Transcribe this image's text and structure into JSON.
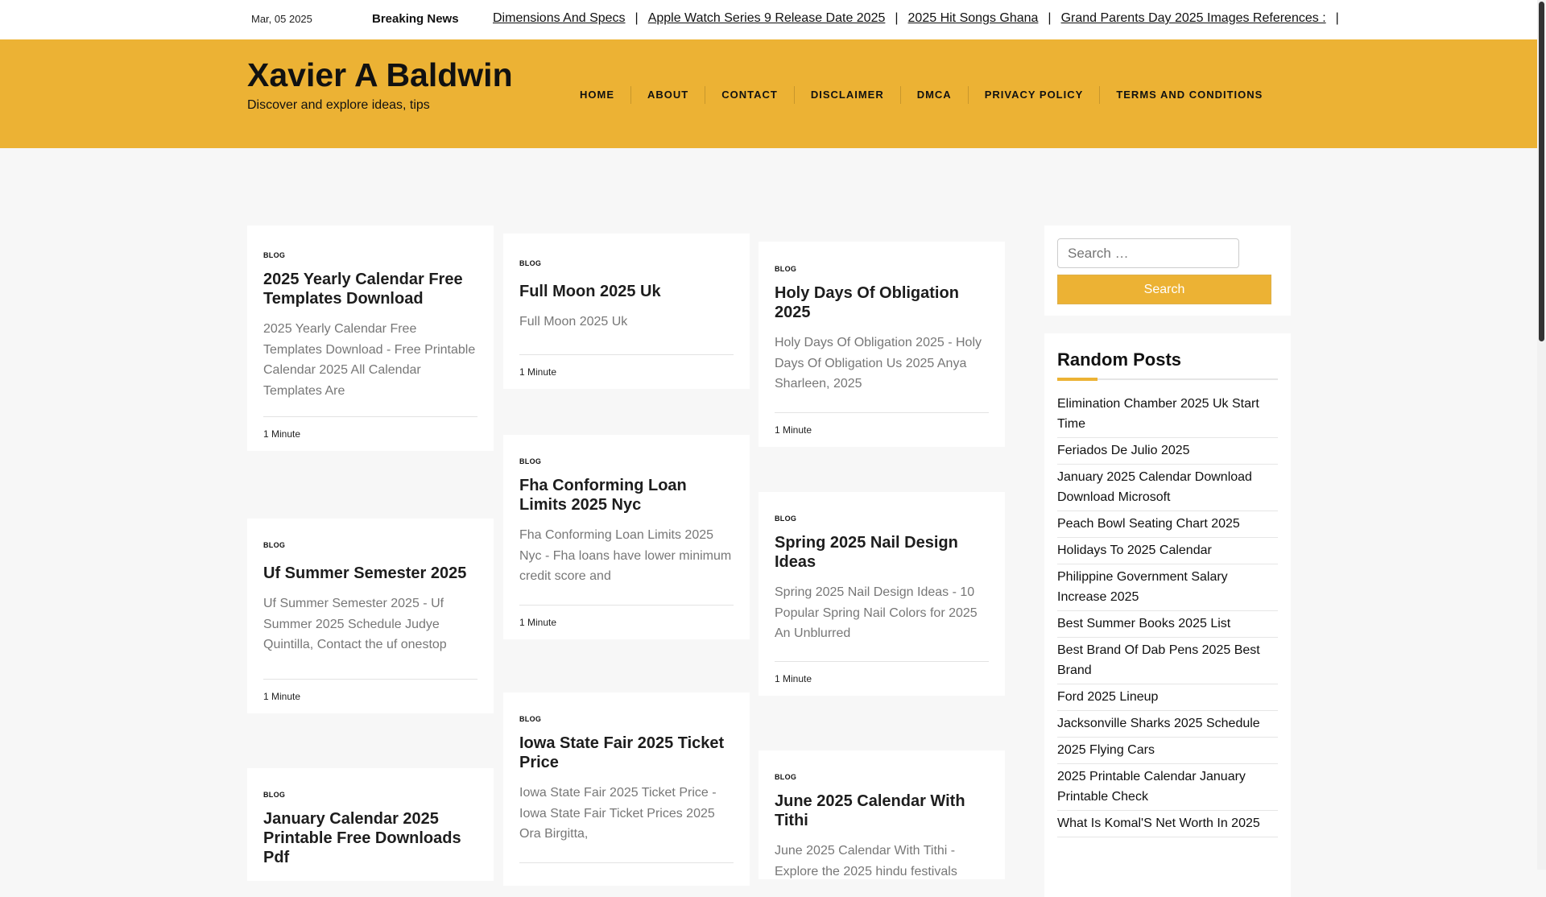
{
  "topbar": {
    "date": "Mar, 05 2025",
    "breaking_label": "Breaking News",
    "ticker": [
      " Dimensions And Specs",
      "Apple Watch Series 9 Release Date 2025",
      "2025 Hit Songs Ghana",
      "Grand Parents Day 2025 Images References :"
    ]
  },
  "site": {
    "title": "Xavier A Baldwin",
    "tagline": "Discover and explore ideas, tips"
  },
  "nav": [
    "HOME",
    "ABOUT",
    "CONTACT",
    "DISCLAIMER",
    "DMCA",
    "PRIVACY POLICY",
    "TERMS AND CONDITIONS"
  ],
  "posts": {
    "p1": {
      "category": "BLOG",
      "title": "2025 Yearly Calendar Free Templates Download",
      "excerpt": "2025 Yearly Calendar Free Templates Download - Free Printable Calendar 2025 All Calendar Templates Are",
      "meta": "1 Minute"
    },
    "p2": {
      "category": "BLOG",
      "title": "Uf Summer Semester 2025",
      "excerpt": "Uf Summer Semester 2025 - Uf Summer 2025 Schedule Judye Quintilla, Contact the uf onestop",
      "meta": "1 Minute"
    },
    "p3": {
      "category": "BLOG",
      "title": "January Calendar 2025 Printable Free Downloads Pdf",
      "excerpt": "",
      "meta": ""
    },
    "p4": {
      "category": "BLOG",
      "title": "Full Moon 2025 Uk",
      "excerpt": "Full Moon 2025 Uk",
      "meta": "1 Minute"
    },
    "p5": {
      "category": "BLOG",
      "title": "Fha Conforming Loan Limits 2025 Nyc",
      "excerpt": "Fha Conforming Loan Limits 2025 Nyc - Fha loans have lower minimum credit score and",
      "meta": "1 Minute"
    },
    "p6": {
      "category": "BLOG",
      "title": "Iowa State Fair 2025 Ticket Price",
      "excerpt": "Iowa State Fair 2025 Ticket Price - Iowa State Fair Ticket Prices 2025 Ora Birgitta,",
      "meta": ""
    },
    "p7": {
      "category": "BLOG",
      "title": "Holy Days Of Obligation 2025",
      "excerpt": "Holy Days Of Obligation 2025 - Holy Days Of Obligation Us 2025 Anya Sharleen, 2025",
      "meta": "1 Minute"
    },
    "p8": {
      "category": "BLOG",
      "title": "Spring 2025 Nail Design Ideas",
      "excerpt": "Spring 2025 Nail Design Ideas - 10 Popular Spring Nail Colors for 2025 An Unblurred",
      "meta": "1 Minute"
    },
    "p9": {
      "category": "BLOG",
      "title": "June 2025 Calendar With Tithi",
      "excerpt": "June 2025 Calendar With Tithi - Explore the 2025 hindu festivals",
      "meta": ""
    }
  },
  "search": {
    "placeholder": "Search …",
    "button_label": "Search"
  },
  "random_posts": {
    "heading": "Random Posts",
    "items": [
      "Elimination Chamber 2025 Uk Start Time",
      "Feriados De Julio 2025",
      "January 2025 Calendar Download Download Microsoft",
      "Peach Bowl Seating Chart 2025",
      "Holidays To 2025 Calendar",
      "Philippine Government Salary Increase 2025",
      "Best Summer Books 2025 List",
      "Best Brand Of Dab Pens 2025 Best Brand",
      "Ford 2025 Lineup",
      "Jacksonville Sharks 2025 Schedule",
      "2025 Flying Cars",
      "2025 Printable Calendar January Printable Check",
      "What Is Komal'S Net Worth In 2025"
    ]
  },
  "colors": {
    "accent": "#ecb234",
    "page_bg": "#f7f7f7",
    "card_bg": "#ffffff"
  }
}
